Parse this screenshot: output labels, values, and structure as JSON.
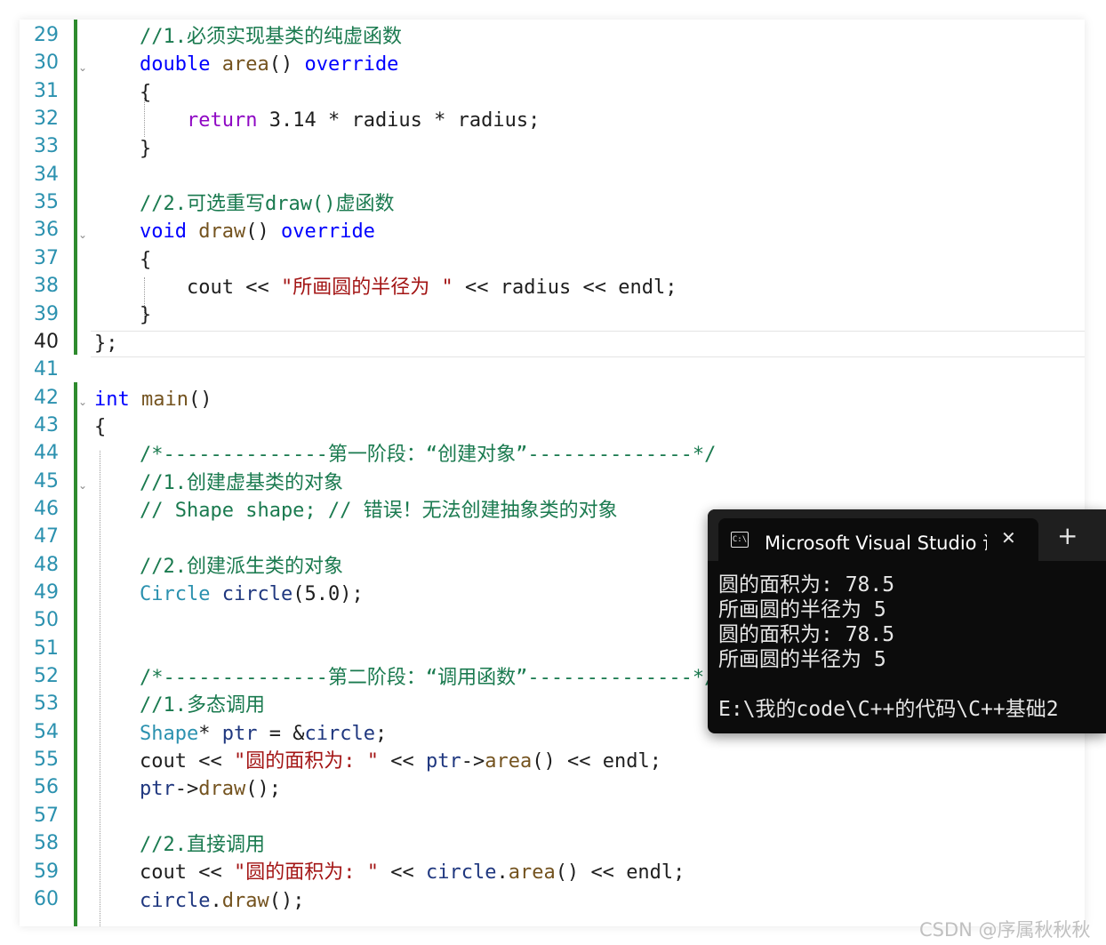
{
  "editor": {
    "line_numbers": [
      "29",
      "30",
      "31",
      "32",
      "33",
      "34",
      "35",
      "36",
      "37",
      "38",
      "39",
      "40",
      "41",
      "42",
      "43",
      "44",
      "45",
      "46",
      "47",
      "48",
      "49",
      "50",
      "51",
      "52",
      "53",
      "54",
      "55",
      "56",
      "57",
      "58",
      "59",
      "60"
    ],
    "active_line": "40",
    "code": {
      "l29": "//1.必须实现基类的纯虚函数",
      "l30_type": "double",
      "l30_fn": "area",
      "l30_paren": "()",
      "l30_kw": "override",
      "brace_open": "{",
      "brace_close": "}",
      "l32_kw": "return",
      "l32_rest": "3.14 * radius * radius;",
      "l35": "//2.可选重写draw()虚函数",
      "l36_type": "void",
      "l36_fn": "draw",
      "l36_paren": "()",
      "l36_kw": "override",
      "l38_cout": "cout",
      "l38_op1": "<<",
      "l38_str": "\"所画圆的半径为 \"",
      "l38_op2": "<<",
      "l38_var": "radius",
      "l38_op3": "<<",
      "l38_endl": "endl",
      "semi": ";",
      "l40": "};",
      "l42_type": "int",
      "l42_fn": "main",
      "l42_paren": "()",
      "l44": "/*--------------第一阶段：“创建对象”--------------*/",
      "l45": "//1.创建虚基类的对象",
      "l46": "// Shape shape; // 错误！无法创建抽象类的对象",
      "l48": "//2.创建派生类的对象",
      "l49_type": "Circle",
      "l49_var": "circle",
      "l49_rest": "(5.0);",
      "l52": "/*--------------第二阶段：“调用函数”--------------*/",
      "l53": "//1.多态调用",
      "l54_type": "Shape",
      "l54_star": "*",
      "l54_var": "ptr",
      "l54_eq": "= &",
      "l54_var2": "circle",
      "l55_cout": "cout",
      "l55_op1": "<<",
      "l55_str": "\"圆的面积为: \"",
      "l55_op2": "<<",
      "l55_var": "ptr",
      "l55_arrow": "->",
      "l55_fn": "area",
      "l55_paren": "()",
      "l55_op3": "<<",
      "l55_endl": "endl",
      "l56_var": "ptr",
      "l56_arrow": "->",
      "l56_fn": "draw",
      "l56_rest": "();",
      "l58": "//2.直接调用",
      "l59_cout": "cout",
      "l59_op1": "<<",
      "l59_str": "\"圆的面积为: \"",
      "l59_op2": "<<",
      "l59_var": "circle",
      "l59_dot": ".",
      "l59_fn": "area",
      "l59_paren": "()",
      "l59_op3": "<<",
      "l59_endl": "endl",
      "l60_var": "circle",
      "l60_dot": ".",
      "l60_fn": "draw",
      "l60_rest": "();"
    }
  },
  "terminal": {
    "tab_title": "Microsoft Visual Studio 调试控制台",
    "icon": "console-icon",
    "close_label": "✕",
    "new_tab_label": "+",
    "output": [
      "圆的面积为: 78.5",
      "所画圆的半径为 5",
      "圆的面积为: 78.5",
      "所画圆的半径为 5",
      "",
      "E:\\我的code\\C++的代码\\C++基础2"
    ]
  },
  "watermark": "CSDN @序属秋秋秋",
  "colors": {
    "keyword": "#0000ff",
    "control_keyword": "#8f08c4",
    "function": "#74531f",
    "type": "#2b91af",
    "variable": "#1f377f",
    "string": "#a31515",
    "comment": "#008000",
    "line_number": "#2b91af",
    "change_bar": "#2e8b2e",
    "terminal_bg": "#0c0c0c"
  }
}
